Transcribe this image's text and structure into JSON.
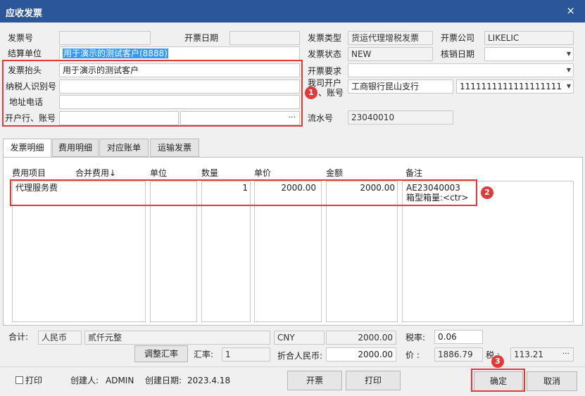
{
  "window": {
    "title": "应收发票",
    "close_glyph": "×"
  },
  "header": {
    "invoice_no": {
      "label": "发票号",
      "value": ""
    },
    "issue_date": {
      "label": "开票日期",
      "value": ""
    },
    "invoice_type": {
      "label": "发票类型",
      "value": "货运代理增税发票"
    },
    "issuing_company": {
      "label": "开票公司",
      "value": "LIKELIC"
    },
    "settlement_unit": {
      "label": "结算单位",
      "value": "用于演示的测试客户(8888)"
    },
    "invoice_status": {
      "label": "发票状态",
      "value": "NEW"
    },
    "writeoff_date": {
      "label": "核销日期",
      "value": ""
    },
    "invoice_title": {
      "label": "发票抬头",
      "value": "用于演示的测试客户"
    },
    "invoice_requirement": {
      "label": "开票要求",
      "value": ""
    },
    "taxpayer_id": {
      "label": "纳税人识别号",
      "value": ""
    },
    "our_bank": {
      "label": "我司开户",
      "label2": "、账号",
      "bank": "工商银行昆山支行",
      "account": "1111111111111111111"
    },
    "address_phone": {
      "label": "地址电话",
      "value": ""
    },
    "bank_account": {
      "label": "开户行、账号",
      "bank": "",
      "account": ""
    },
    "serial_no": {
      "label": "流水号",
      "value": "23040010"
    }
  },
  "tabs": [
    {
      "label": "发票明细"
    },
    {
      "label": "费用明细"
    },
    {
      "label": "对应账单"
    },
    {
      "label": "运输发票"
    }
  ],
  "grid": {
    "headers": {
      "item": "费用项目",
      "merge": "合并费用↓",
      "unit": "单位",
      "qty": "数量",
      "price": "单价",
      "amount": "金额",
      "remark": "备注"
    },
    "rows": [
      {
        "item": "代理服务费",
        "unit": "",
        "qty": "1",
        "price": "2000.00",
        "amount": "2000.00",
        "remark_line1": "AE23040003",
        "remark_line2": "箱型箱量:<ctr>"
      }
    ]
  },
  "totals": {
    "label": "合计:",
    "currency": "人民币",
    "amount_words": "贰仟元整",
    "currency_code": "CNY",
    "amount": "2000.00",
    "tax_rate_label": "税率:",
    "tax_rate": "0.06",
    "adjust_rate_button": "调整汇率",
    "exchange_rate_label": "汇率:",
    "exchange_rate": "1",
    "rmb_label": "折合人民币:",
    "rmb_amount": "2000.00",
    "price_label": "价 :",
    "price": "1886.79",
    "tax_label": "税 :",
    "tax": "113.21"
  },
  "footer": {
    "print_checkbox": "打印",
    "creator_label": "创建人:",
    "creator": "ADMIN",
    "created_date_label": "创建日期:",
    "created_date": "2023.4.18",
    "issue_button": "开票",
    "print_button": "打印",
    "confirm_button": "确定",
    "cancel_button": "取消"
  },
  "annotations": [
    "1",
    "2",
    "3"
  ],
  "colors": {
    "titlebar": "#2b579a",
    "highlight": "#e03a3a",
    "selection": "#3399ff"
  }
}
